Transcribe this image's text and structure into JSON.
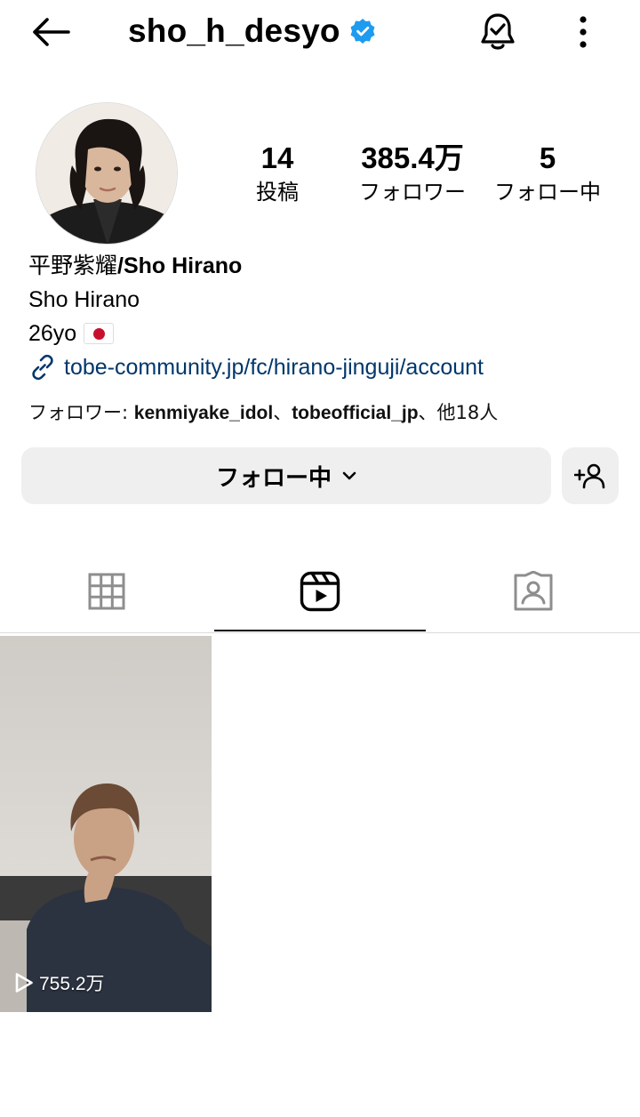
{
  "header": {
    "username": "sho_h_desyo",
    "verified": true,
    "icons": [
      "back-arrow-icon",
      "verified-badge-icon",
      "notification-bell-icon",
      "more-options-icon"
    ]
  },
  "profile": {
    "stats": {
      "posts_count": "14",
      "posts_label": "投稿",
      "followers_count": "385.4万",
      "followers_label": "フォロワー",
      "following_count": "5",
      "following_label": "フォロー中"
    },
    "bio": {
      "name_jp": "平野紫耀",
      "name_en": "/Sho Hirano",
      "subtitle": "Sho Hirano",
      "age": "26yo",
      "flag": "japan-flag-icon",
      "link": "tobe-community.jp/fc/hirano-jinguji/account"
    },
    "followed_by": {
      "prefix": "フォロワー: ",
      "user1": "kenmiyake_idol",
      "sep": "、",
      "user2": "tobeofficial_jp",
      "suffix": "、他18人"
    }
  },
  "actions": {
    "following_label": "フォロー中",
    "add_user_icon": "add-user-icon"
  },
  "tabs": [
    {
      "name": "grid",
      "icon": "grid-icon",
      "active": false
    },
    {
      "name": "reels",
      "icon": "reels-icon",
      "active": true
    },
    {
      "name": "tagged",
      "icon": "tagged-icon",
      "active": false
    }
  ],
  "reels": [
    {
      "views": "755.2万"
    }
  ],
  "colors": {
    "link": "#00376b",
    "verified": "#1d9bf0",
    "button_bg": "#efefef",
    "divider": "#dbdbdb"
  }
}
